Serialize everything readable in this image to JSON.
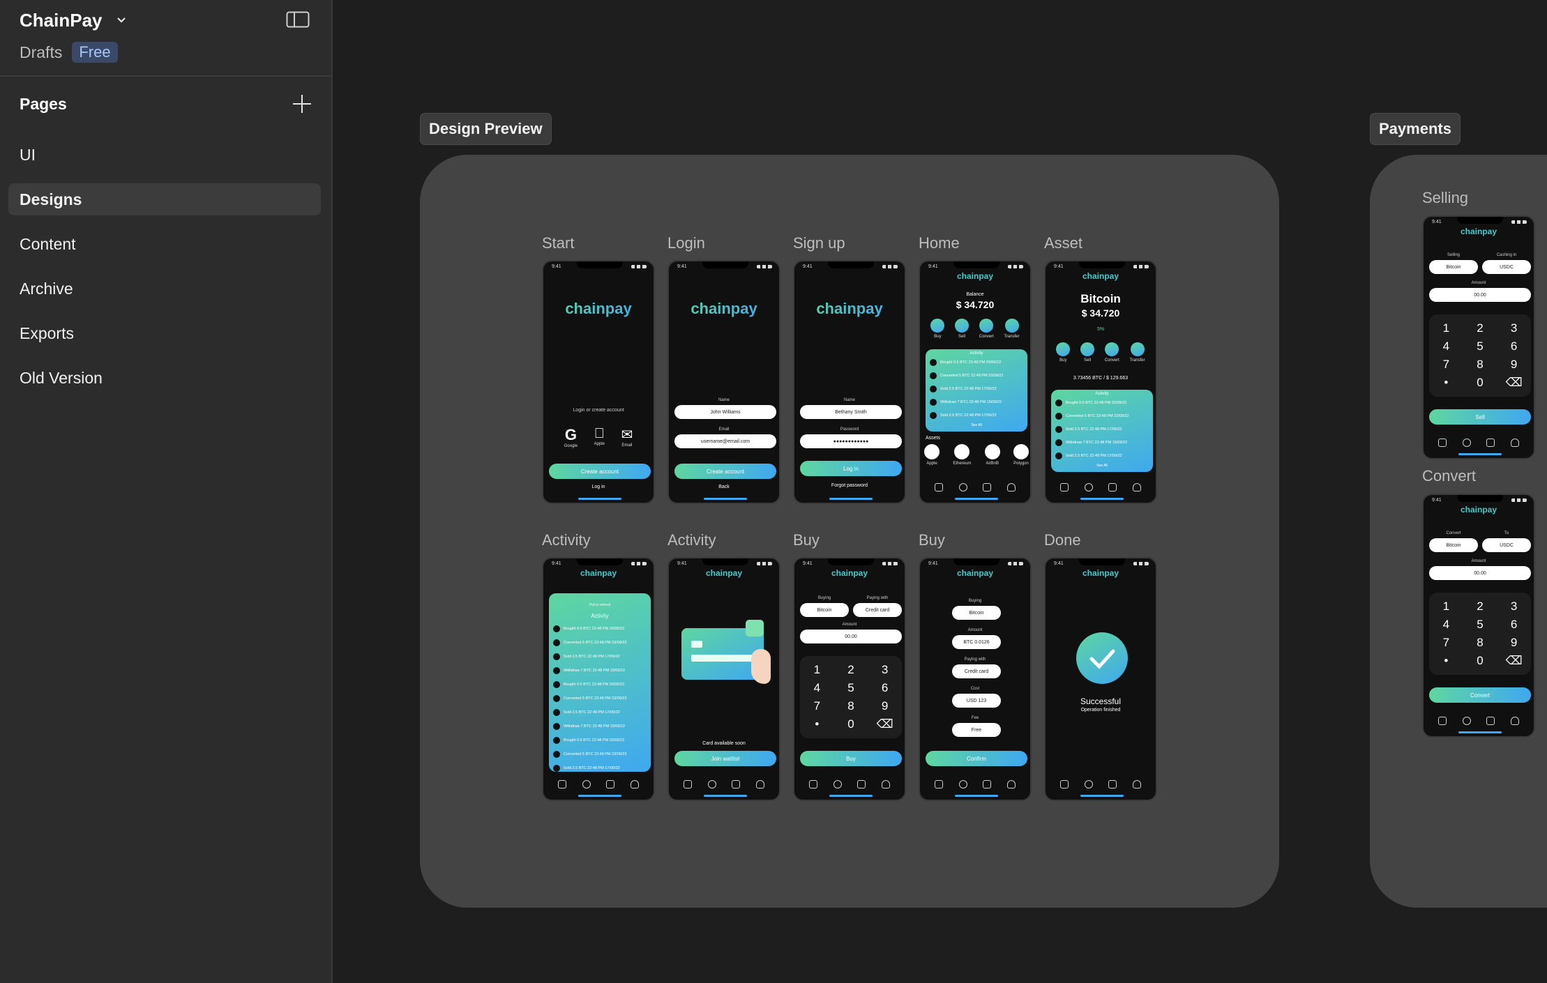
{
  "sidebar": {
    "workspace": "ChainPay",
    "drafts": "Drafts",
    "plan": "Free",
    "pages_title": "Pages",
    "pages": [
      "UI",
      "Designs",
      "Content",
      "Archive",
      "Exports",
      "Old Version"
    ],
    "active_page": "Designs"
  },
  "canvas": {
    "frames": [
      "Design Preview",
      "Payments"
    ],
    "screens_row1": [
      "Start",
      "Login",
      "Sign up",
      "Home",
      "Asset"
    ],
    "screens_row2": [
      "Activity",
      "Activity",
      "Buy",
      "Buy",
      "Done"
    ],
    "payments_screens": [
      "Selling",
      "Convert"
    ]
  },
  "app": {
    "logo": "chainpay",
    "time": "9:41",
    "start": {
      "prompt": "Login or create account",
      "google": "Google",
      "apple": "Apple",
      "email": "Email",
      "create": "Create account",
      "login": "Log in"
    },
    "login": {
      "name_label": "Name",
      "name_value": "John Williams",
      "email_label": "Email",
      "email_value": "username@email.com",
      "create": "Create account",
      "back": "Back"
    },
    "signup": {
      "name_label": "Name",
      "name_value": "Bethany Smith",
      "password_label": "Password",
      "password_value": "●●●●●●●●●●●●",
      "login": "Log in",
      "forgot": "Forgot password"
    },
    "home": {
      "balance_label": "Balance",
      "balance": "$ 34.720",
      "actions": [
        "Buy",
        "Sell",
        "Convert",
        "Transfer"
      ],
      "activity": "Activity",
      "rows": [
        "Bought 0.5 BTC 22:48 PM 20/09/22",
        "Converted 5 BTC 22:48 PM 23/09/22",
        "Sold 2.5 BTC 22:48 PM 17/09/22",
        "Withdraw 7 BTC 22:48 PM 15/09/22",
        "Sold 2.5 BTC 22:48 PM 17/09/22"
      ],
      "see_all": "See All",
      "assets": "Assets",
      "asset_names": [
        "Apple",
        "Ethereum",
        "AirBnB",
        "Polygon"
      ]
    },
    "asset": {
      "title": "Bitcoin",
      "balance": "$ 34.720",
      "change": "5%",
      "holding": "3.73456 BTC / $ 129.663",
      "activity": "Activity",
      "see_all": "See All"
    },
    "activity_list": {
      "pull": "Pull to refresh",
      "title": "Activity",
      "rows": [
        "Bought 0.5 BTC 22:48 PM 20/09/22",
        "Converted 5 BTC 22:48 PM 23/09/22",
        "Sold 2.5 BTC 22:48 PM 17/09/22",
        "Withdraw 7 BTC 22:48 PM 15/09/22",
        "Bought 0.5 BTC 22:48 PM 20/09/22",
        "Converted 5 BTC 22:48 PM 23/09/22",
        "Sold 2.5 BTC 22:48 PM 17/09/22",
        "Withdraw 7 BTC 22:48 PM 15/09/22",
        "Bought 0.5 BTC 22:48 PM 20/09/22",
        "Converted 5 BTC 22:48 PM 23/09/22",
        "Sold 2.5 BTC 22:48 PM 17/09/22"
      ]
    },
    "card": {
      "note": "Card available soon",
      "join": "Join waitlist"
    },
    "buy1": {
      "buying_label": "Buying",
      "buying": "Bitcoin",
      "paying_label": "Paying with",
      "paying": "Credit card",
      "amount_label": "Amount",
      "amount": "00.00",
      "keys": [
        "1",
        "2",
        "3",
        "4",
        "5",
        "6",
        "7",
        "8",
        "9",
        "•",
        "0",
        "⌫"
      ],
      "cta": "Buy"
    },
    "buy2": {
      "buying_label": "Buying",
      "buying": "Bitcoin",
      "amount_label": "Amount",
      "amount": "BTC 0.0126",
      "paying_label": "Paying with",
      "paying": "Credit card",
      "cost_label": "Cost",
      "cost": "USD 123",
      "fee_label": "Fee",
      "fee": "Free",
      "cta": "Confirm"
    },
    "done": {
      "title": "Successful",
      "sub": "Operation finished"
    },
    "selling": {
      "left_label": "Selling",
      "left": "Bitcoin",
      "right_label": "Cashing in",
      "right": "USDC",
      "amount_label": "Amount",
      "amount": "00.00",
      "cta": "Sell"
    },
    "convert": {
      "left_label": "Convert",
      "left": "Bitcoin",
      "right_label": "To",
      "right": "USDC",
      "amount_label": "Amount",
      "amount": "00.00",
      "cta": "Convert"
    }
  }
}
